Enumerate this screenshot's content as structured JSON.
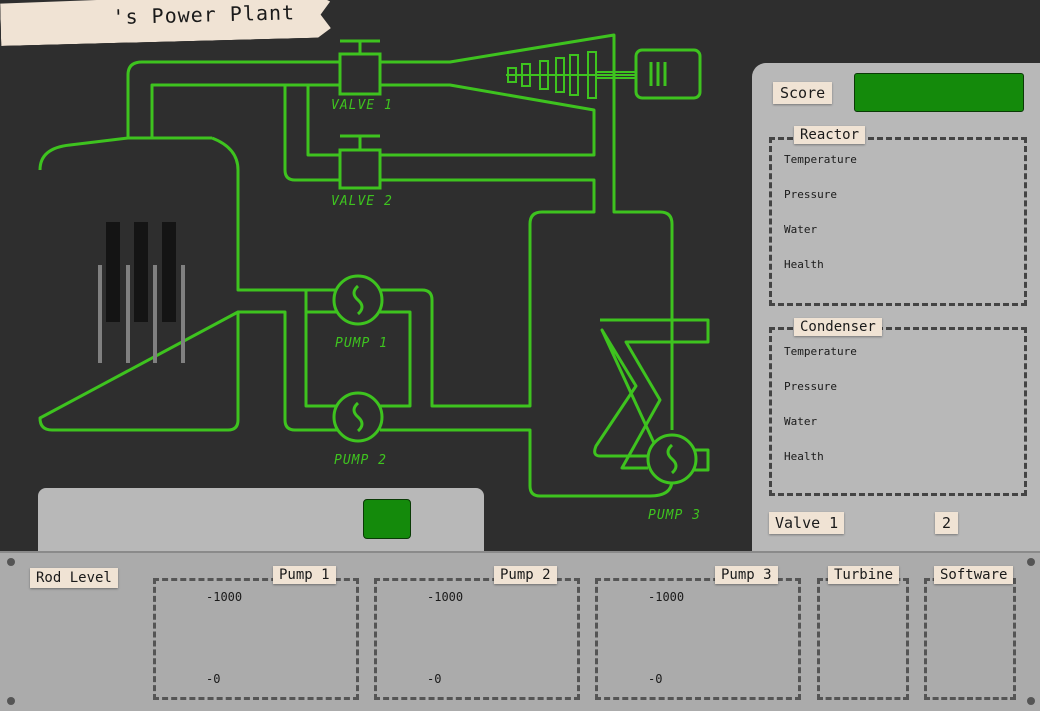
{
  "app": {
    "title": "'s Power Plant"
  },
  "diagram": {
    "valve1_label": "VALVE 1",
    "valve2_label": "VALVE 2",
    "pump1_label": "PUMP 1",
    "pump2_label": "PUMP 2",
    "pump3_label": "PUMP 3"
  },
  "score": {
    "label": "Score"
  },
  "reactor": {
    "title": "Reactor",
    "metrics": [
      "Temperature",
      "Pressure",
      "Water",
      "Health"
    ]
  },
  "condenser": {
    "title": "Condenser",
    "metrics": [
      "Temperature",
      "Pressure",
      "Water",
      "Health"
    ]
  },
  "valve_selector": {
    "label": "Valve 1",
    "value": "2"
  },
  "controls": {
    "rod_level_label": "Rod Level",
    "pump1": {
      "label": "Pump 1",
      "max": "-1000",
      "min": "-0"
    },
    "pump2": {
      "label": "Pump 2",
      "max": "-1000",
      "min": "-0"
    },
    "pump3": {
      "label": "Pump 3",
      "max": "-1000",
      "min": "-0"
    },
    "turbine_label": "Turbine",
    "software_label": "Software"
  },
  "colors": {
    "pipe": "#3ec31f",
    "indicator": "#148a0b",
    "panel": "#b8b8b8",
    "tape": "#f0e3d4",
    "background": "#2e2e2e"
  }
}
